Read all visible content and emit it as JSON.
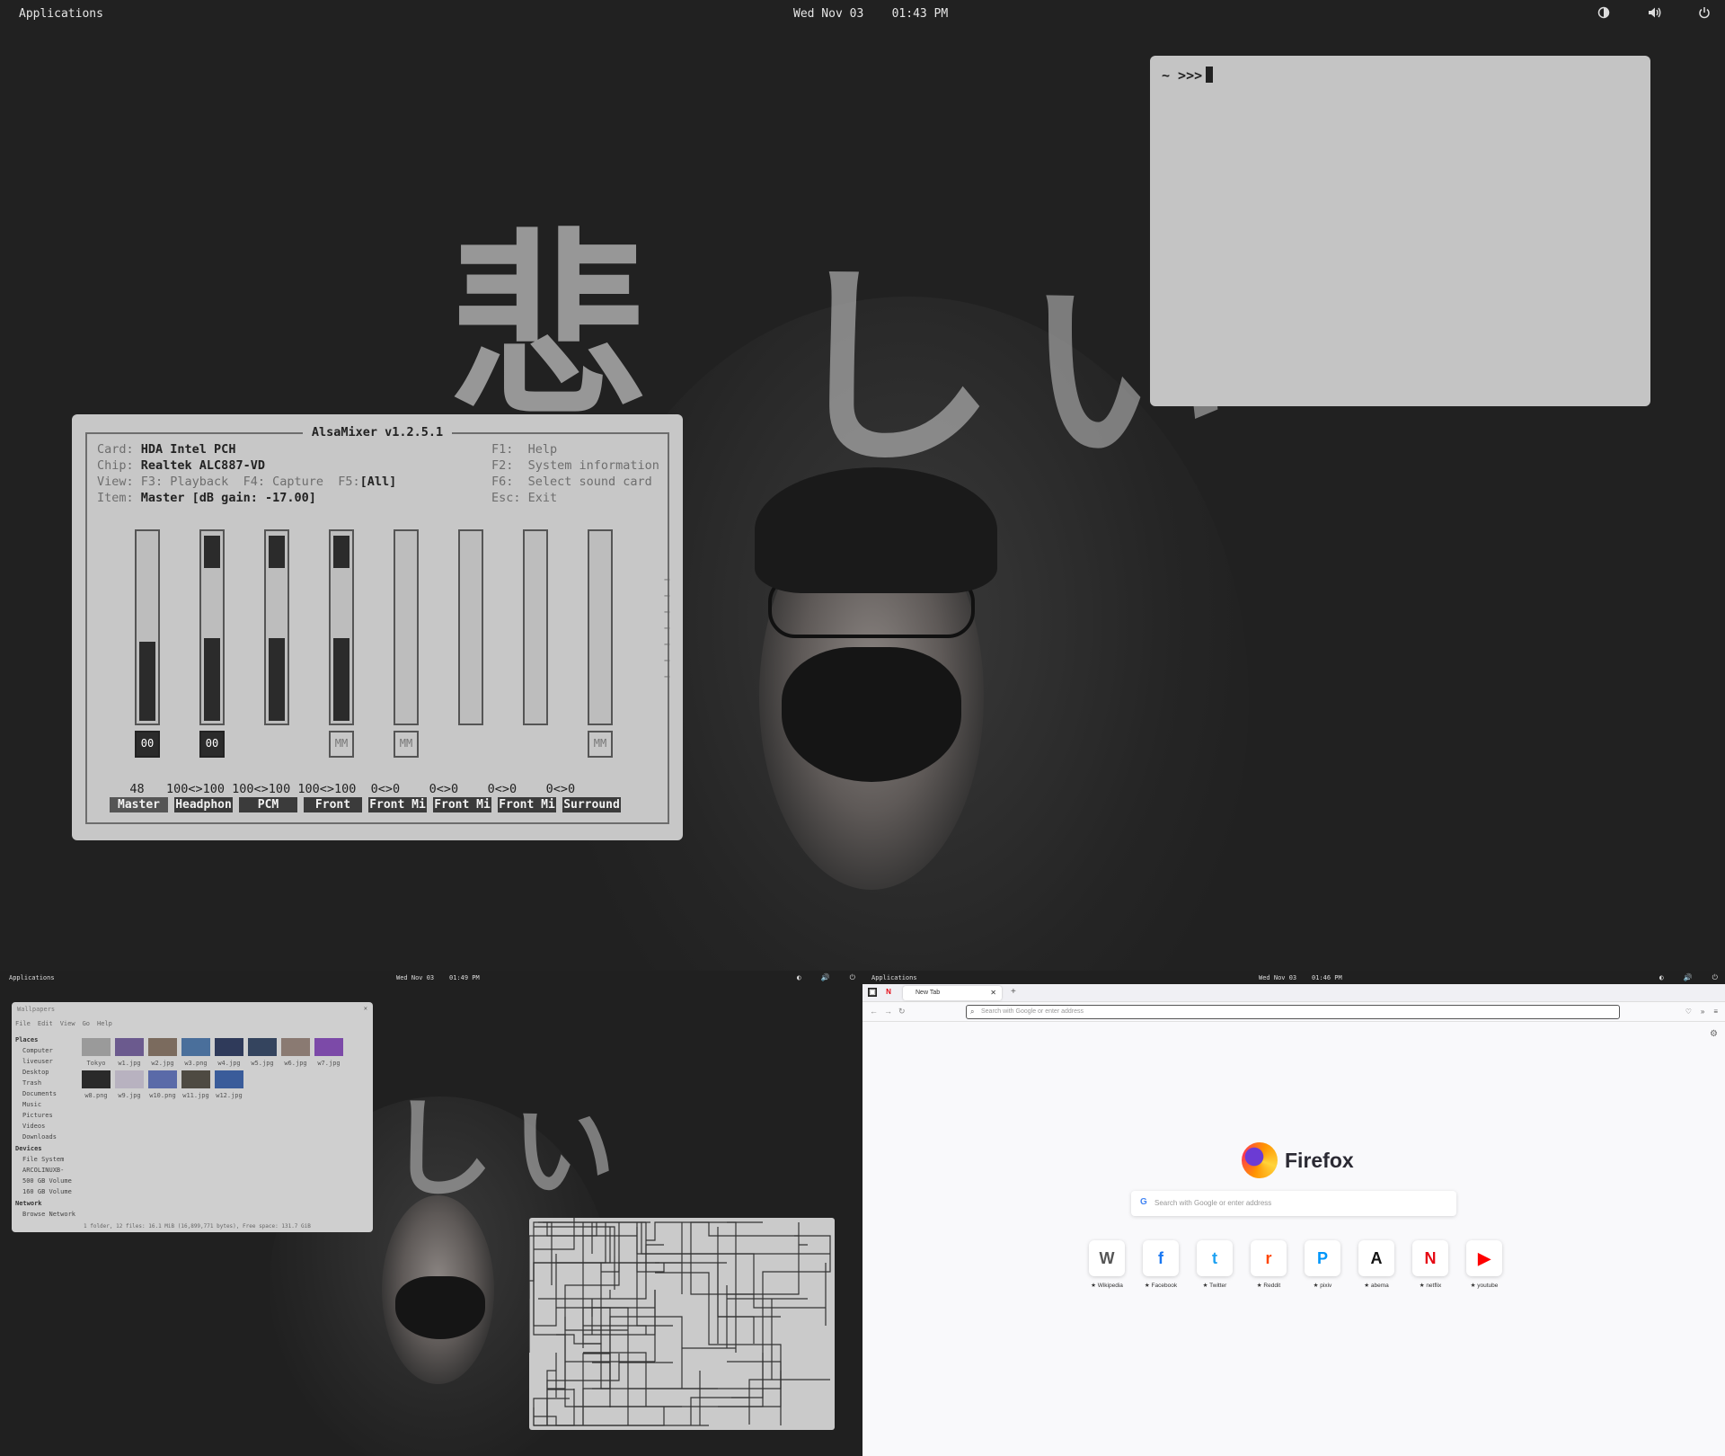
{
  "main": {
    "topbar": {
      "apps": "Applications",
      "date": "Wed Nov 03",
      "time": "01:43 PM",
      "tray_icons": [
        "theme-icon",
        "volume-icon",
        "power-icon"
      ]
    },
    "wallpaper_text": "悲しい",
    "terminal": {
      "prompt": "~ >>>"
    },
    "alsamixer": {
      "title": "AlsaMixer v1.2.5.1",
      "card_label": "Card:",
      "card": "HDA Intel PCH",
      "chip_label": "Chip:",
      "chip": "Realtek ALC887-VD",
      "view_label": "View:",
      "view": "F3: Playback  F4: Capture  F5:",
      "view_sel": "[All]",
      "item_label": "Item:",
      "item": "Master [dB gain: -17.00]",
      "keys": [
        "F1:  Help",
        "F2:  System information",
        "F6:  Select sound card",
        "Esc: Exit"
      ],
      "channels": [
        {
          "name": "Master",
          "value": "48",
          "tag": "00",
          "tag_state": "on",
          "level": 0.48,
          "selected": true
        },
        {
          "name": "Headphon",
          "value": "100<>100",
          "tag": "00",
          "tag_state": "on",
          "level": 1.0
        },
        {
          "name": "PCM",
          "value": "100<>100",
          "tag": "",
          "tag_state": "none",
          "level": 1.0
        },
        {
          "name": "Front",
          "value": "100<>100",
          "tag": "MM",
          "tag_state": "off",
          "level": 1.0
        },
        {
          "name": "Front Mi",
          "value": "0<>0",
          "tag": "MM",
          "tag_state": "off",
          "level": 0
        },
        {
          "name": "Front Mi",
          "value": "0<>0",
          "tag": "",
          "tag_state": "none",
          "level": 0
        },
        {
          "name": "Front Mi",
          "value": "0<>0",
          "tag": "",
          "tag_state": "none",
          "level": 0
        },
        {
          "name": "Surround",
          "value": "0<>0",
          "tag": "MM",
          "tag_state": "off",
          "level": 0
        }
      ],
      "values_line": "   48   100<>100 100<>100 100<>100  0<>0    0<>0    0<>0    0<>0"
    }
  },
  "bottom_left": {
    "topbar": {
      "apps": "Applications",
      "date": "Wed Nov 03",
      "time": "01:49 PM"
    },
    "file_manager": {
      "title": "Wallpapers",
      "menu": [
        "File",
        "Edit",
        "View",
        "Go",
        "Help"
      ],
      "places_header": "Places",
      "places": [
        "Computer",
        "liveuser",
        "Desktop",
        "Trash",
        "Documents",
        "Music",
        "Pictures",
        "Videos",
        "Downloads"
      ],
      "devices_header": "Devices",
      "devices": [
        "File System",
        "ARCOLINUXB-",
        "500 GB Volume",
        "160 GB Volume"
      ],
      "network_header": "Network",
      "network": [
        "Browse Network"
      ],
      "files": [
        {
          "name": "Tokyo",
          "color": "#9a9a9a"
        },
        {
          "name": "w1.jpg",
          "color": "#6b5a8e"
        },
        {
          "name": "w2.jpg",
          "color": "#7b6b5e"
        },
        {
          "name": "w3.png",
          "color": "#4a6f9b"
        },
        {
          "name": "w4.jpg",
          "color": "#2f3a5a"
        },
        {
          "name": "w5.jpg",
          "color": "#34445e"
        },
        {
          "name": "w6.jpg",
          "color": "#8a7a72"
        },
        {
          "name": "w7.jpg",
          "color": "#7c4aa8"
        },
        {
          "name": "w8.png",
          "color": "#2a2a2a"
        },
        {
          "name": "w9.jpg",
          "color": "#b8b2c0"
        },
        {
          "name": "w10.png",
          "color": "#5a6aa8"
        },
        {
          "name": "w11.jpg",
          "color": "#4e4a42"
        },
        {
          "name": "w12.jpg",
          "color": "#3a5c9a"
        }
      ],
      "status": "1 folder, 12 files: 16.1 MiB (16,899,771 bytes), Free space: 131.7 GiB"
    }
  },
  "bottom_right": {
    "topbar": {
      "apps": "Applications",
      "date": "Wed Nov 03",
      "time": "01:46 PM"
    },
    "firefox": {
      "tab_label": "New Tab",
      "url_placeholder": "Search with Google or enter address",
      "brand": "Firefox",
      "search_placeholder": "Search with Google or enter address",
      "sites": [
        {
          "label": "Wikipedia",
          "glyph": "W",
          "color": "#555"
        },
        {
          "label": "Facebook",
          "glyph": "f",
          "color": "#1877f2"
        },
        {
          "label": "Twitter",
          "glyph": "t",
          "color": "#1da1f2"
        },
        {
          "label": "Reddit",
          "glyph": "r",
          "color": "#ff4500"
        },
        {
          "label": "pixiv",
          "glyph": "P",
          "color": "#0096fa"
        },
        {
          "label": "abema",
          "glyph": "A",
          "color": "#111"
        },
        {
          "label": "netflix",
          "glyph": "N",
          "color": "#e50914"
        },
        {
          "label": "youtube",
          "glyph": "▶",
          "color": "#ff0000"
        }
      ]
    }
  }
}
